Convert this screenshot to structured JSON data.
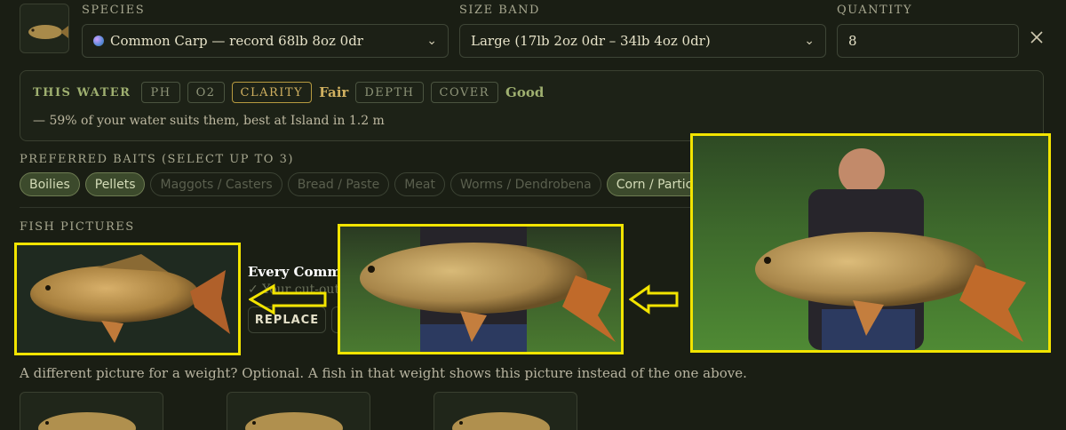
{
  "species": {
    "label": "SPECIES",
    "value": "Common Carp — record 68lb 8oz 0dr",
    "icon": "fish-icon"
  },
  "size_band": {
    "label": "SIZE BAND",
    "value": "Large (17lb 2oz 0dr – 34lb 4oz 0dr)"
  },
  "quantity": {
    "label": "QUANTITY",
    "value": "8"
  },
  "this_water": {
    "label": "THIS WATER",
    "tags": [
      "PH",
      "O2",
      "CLARITY",
      "DEPTH",
      "COVER"
    ],
    "clarity_rating": "Fair",
    "cover_rating": "Good",
    "summary": "— 59% of your water suits them, best at Island in 1.2 m",
    "colors": {
      "active": "#d0b060",
      "good": "#9fb070"
    }
  },
  "baits": {
    "label": "PREFERRED BAITS (SELECT UP TO 3)",
    "items": [
      {
        "label": "Boilies",
        "selected": true
      },
      {
        "label": "Pellets",
        "selected": true
      },
      {
        "label": "Maggots / Casters",
        "selected": false
      },
      {
        "label": "Bread / Paste",
        "selected": false
      },
      {
        "label": "Meat",
        "selected": false
      },
      {
        "label": "Worms / Dendrobena",
        "selected": false
      },
      {
        "label": "Corn / Particle",
        "selected": true
      }
    ]
  },
  "pictures": {
    "label": "FISH PICTURES",
    "caption_title": "Every Common",
    "caption_sub": "✓ Your cut-out",
    "replace_label": "REPLACE",
    "weight_note": "A different picture for a weight? Optional. A fish in that weight shows this picture instead of the one above."
  },
  "annotation": {
    "highlight_color": "#f2e400"
  }
}
